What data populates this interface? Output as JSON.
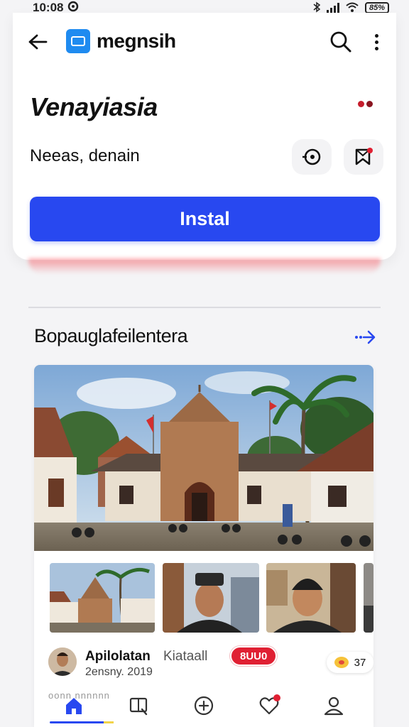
{
  "status_bar": {
    "time": "10:08",
    "battery": "85%"
  },
  "app_bar": {
    "brand_name": "megnsih"
  },
  "app": {
    "title": "Venayiasia",
    "subtitle": "Neeas, denain",
    "install_label": "Instal"
  },
  "section": {
    "title": "Bopauglafeilentera"
  },
  "post": {
    "author_name": "Apilolatan",
    "author_sub": "Kiataall",
    "badge": "8UU0",
    "date": "2ensny. 2019",
    "reaction_count": "37",
    "faded_text": "oonn nnnnnn"
  },
  "icons": {
    "back": "arrow-left-icon",
    "search": "search-icon",
    "more": "more-vertical-icon",
    "eye_action": "eye-icon",
    "save_action": "bookmark-icon",
    "section_more": "arrow-right-icon",
    "nav_home": "home-icon",
    "nav_browse": "book-icon",
    "nav_add": "plus-circle-icon",
    "nav_favorites": "heart-icon",
    "nav_profile": "user-icon"
  },
  "colors": {
    "accent": "#2848f0",
    "logo": "#1f8bf0",
    "badge": "#e02033",
    "indicator": "#c61d2c"
  }
}
